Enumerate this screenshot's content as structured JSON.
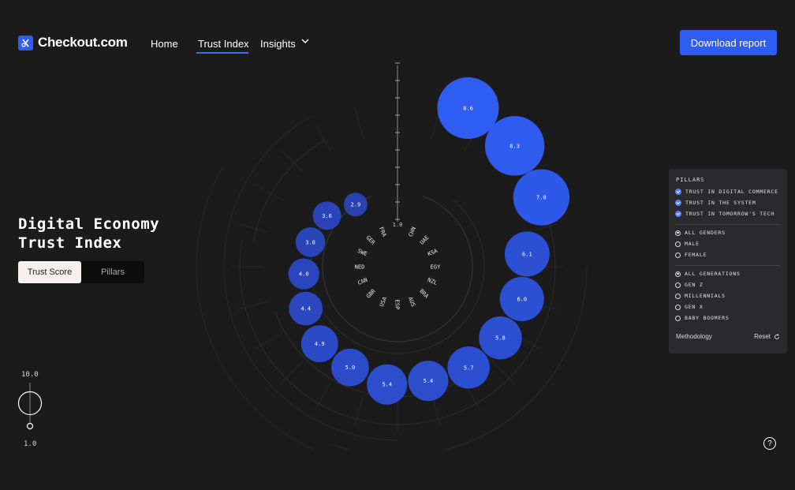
{
  "brand": {
    "name": "Checkout.com"
  },
  "nav": {
    "home": "Home",
    "trust_index": "Trust Index",
    "insights": "Insights"
  },
  "header": {
    "download": "Download report"
  },
  "hero": {
    "title_line1": "Digital Economy",
    "title_line2": "Trust Index"
  },
  "view_toggle": {
    "active": "Trust Score",
    "inactive": "Pillars"
  },
  "scale": {
    "max": "10.0",
    "min": "1.0",
    "axis_label": "1.0"
  },
  "panel": {
    "title": "PILLARS",
    "pillars": [
      "TRUST IN DIGITAL COMMERCE",
      "TRUST IN THE SYSTEM",
      "TRUST IN TOMORROW'S TECH"
    ],
    "genders": [
      "ALL GENDERS",
      "MALE",
      "FEMALE"
    ],
    "generations": [
      "ALL GENERATIONS",
      "GEN Z",
      "MILLENNIALS",
      "GEN X",
      "BABY BOOMERS"
    ],
    "methodology": "Methodology",
    "reset": "Reset"
  },
  "countries": [
    "CHN",
    "UAE",
    "KSA",
    "EGY",
    "NZL",
    "BRA",
    "AUS",
    "ESP",
    "USA",
    "GBR",
    "CAN",
    "NED",
    "SWE",
    "GER",
    "FRA"
  ],
  "scores": [
    {
      "label": "8.6",
      "value": 8.6
    },
    {
      "label": "8.3",
      "value": 8.3
    },
    {
      "label": "7.8",
      "value": 7.8
    },
    {
      "label": "6.1",
      "value": 6.1
    },
    {
      "label": "6.0",
      "value": 6.0
    },
    {
      "label": "5.8",
      "value": 5.8
    },
    {
      "label": "5.7",
      "value": 5.7
    },
    {
      "label": "5.4",
      "value": 5.4
    },
    {
      "label": "5.4",
      "value": 5.4
    },
    {
      "label": "5.0",
      "value": 5.0
    },
    {
      "label": "4.9",
      "value": 4.9
    },
    {
      "label": "4.4",
      "value": 4.4
    },
    {
      "label": "4.0",
      "value": 4.0
    },
    {
      "label": "3.8",
      "value": 3.8
    },
    {
      "label": "3.6",
      "value": 3.6
    },
    {
      "label": "2.9",
      "value": 2.9
    }
  ]
}
